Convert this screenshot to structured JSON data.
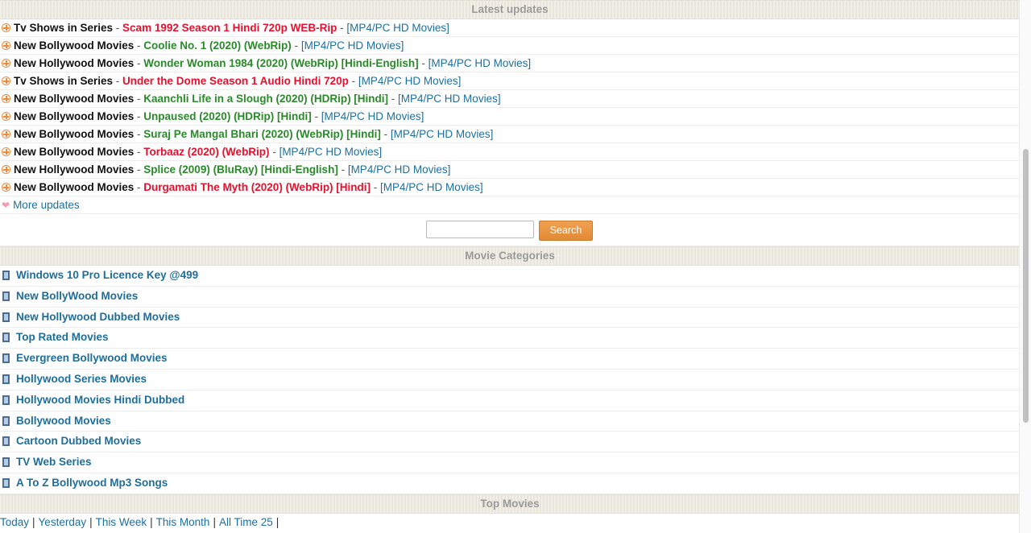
{
  "latest": {
    "header": "Latest updates",
    "items": [
      {
        "category": "Tv Shows in Series",
        "title": "Scam 1992 Season 1 Hindi 720p WEB-Rip",
        "color": "red",
        "tag": "[MP4/PC HD Movies]"
      },
      {
        "category": "New Bollywood Movies",
        "title": "Coolie No. 1 (2020) (WebRip)",
        "color": "green",
        "tag": "[MP4/PC HD Movies]"
      },
      {
        "category": "New Hollywood Movies",
        "title": "Wonder Woman 1984 (2020) (WebRip) [Hindi-English]",
        "color": "green",
        "tag": "[MP4/PC HD Movies]"
      },
      {
        "category": "Tv Shows in Series",
        "title": "Under the Dome Season 1 Audio Hindi 720p",
        "color": "red",
        "tag": "[MP4/PC HD Movies]"
      },
      {
        "category": "New Bollywood Movies",
        "title": "Kaanchli Life in a Slough (2020) (HDRip) [Hindi]",
        "color": "green",
        "tag": "[MP4/PC HD Movies]"
      },
      {
        "category": "New Bollywood Movies",
        "title": "Unpaused (2020) (HDRip) [Hindi]",
        "color": "green",
        "tag": "[MP4/PC HD Movies]"
      },
      {
        "category": "New Bollywood Movies",
        "title": "Suraj Pe Mangal Bhari (2020) (WebRip) [Hindi]",
        "color": "green",
        "tag": "[MP4/PC HD Movies]"
      },
      {
        "category": "New Bollywood Movies",
        "title": "Torbaaz (2020) (WebRip)",
        "color": "red",
        "tag": "[MP4/PC HD Movies]"
      },
      {
        "category": "New Hollywood Movies",
        "title": "Splice (2009) (BluRay) [Hindi-English]",
        "color": "green",
        "tag": "[MP4/PC HD Movies]"
      },
      {
        "category": "New Bollywood Movies",
        "title": "Durgamati The Myth (2020) (WebRip) [Hindi]",
        "color": "red",
        "tag": "[MP4/PC HD Movies]"
      }
    ],
    "separator": " - ",
    "more_label": "More updates"
  },
  "search": {
    "button_label": "Search",
    "value": ""
  },
  "categories": {
    "header": "Movie Categories",
    "items": [
      "Windows 10 Pro Licence Key @499",
      "New BollyWood Movies",
      "New Hollywood Dubbed Movies",
      "Top Rated Movies",
      "Evergreen Bollywood Movies",
      "Hollywood Series Movies",
      "Hollywood Movies Hindi Dubbed",
      "Bollywood Movies",
      "Cartoon Dubbed Movies",
      "TV Web Series",
      "A To Z Bollywood Mp3 Songs"
    ]
  },
  "top_movies": {
    "header": "Top Movies",
    "links": [
      "Today",
      "Yesterday",
      "This Week",
      "This Month",
      "All Time 25"
    ],
    "divider": "|"
  },
  "colors": {
    "red": "#e8112d",
    "green": "#2a8a2a",
    "link": "#1e6fa0",
    "accent": "#e28a34"
  }
}
